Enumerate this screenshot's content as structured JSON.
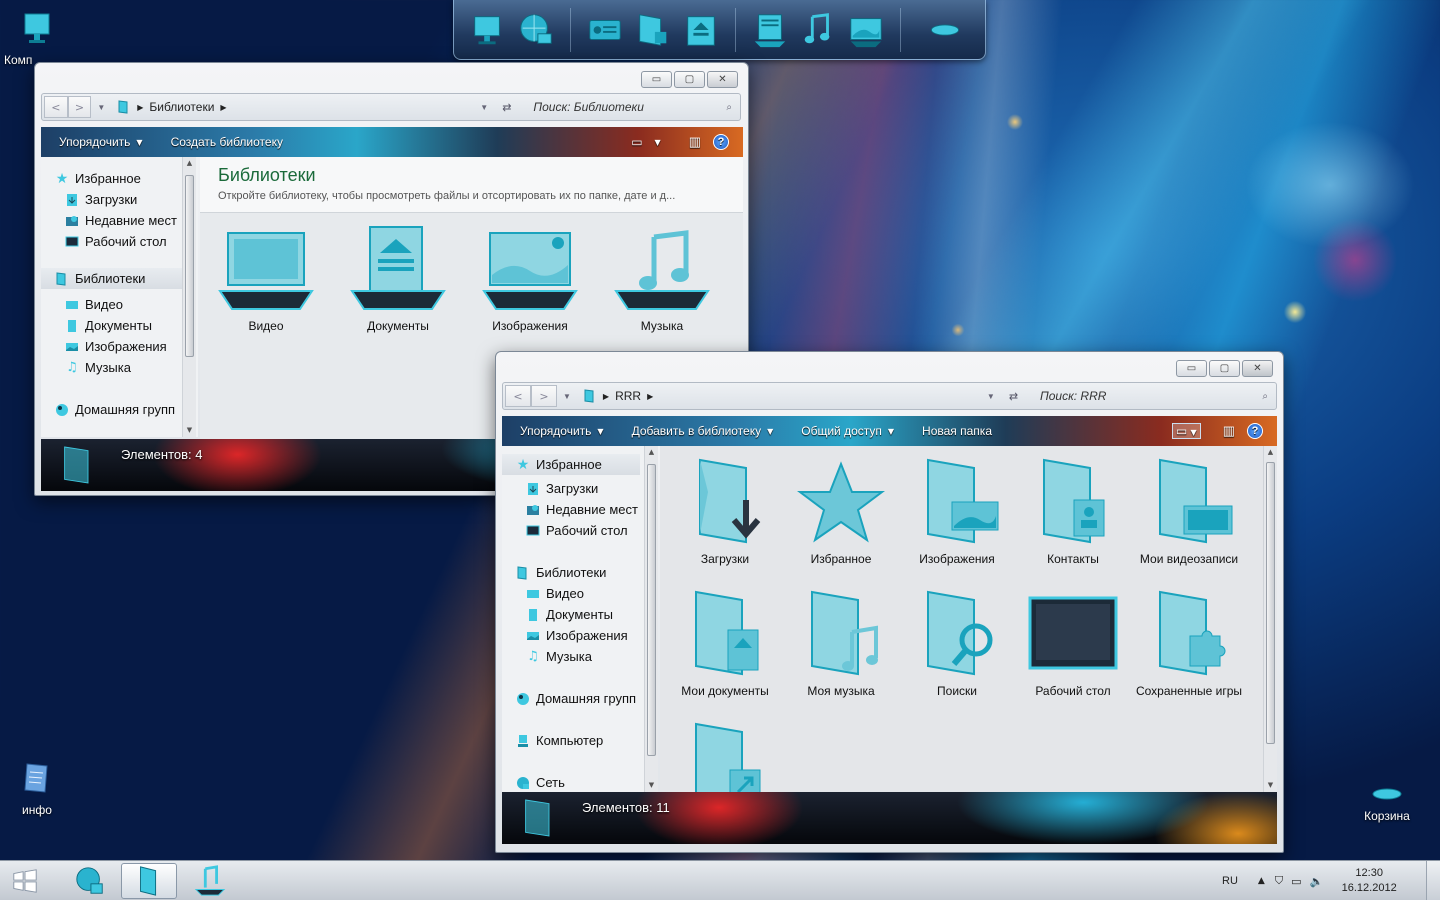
{
  "desktop": {
    "icons": [
      {
        "label": "Комп"
      },
      {
        "label": "инфо"
      },
      {
        "label": "Корзина"
      }
    ]
  },
  "dock": {
    "items": [
      "monitor-icon",
      "globe-icon",
      "display-icon",
      "folder-puzzle-icon",
      "eject-icon",
      "documents-icon",
      "music-icon",
      "picture-icon",
      "switch-icon"
    ]
  },
  "window1": {
    "controls": {
      "minimize": "▭",
      "maximize": "▢",
      "close": "✕"
    },
    "address": {
      "crumb": "Библиотеки"
    },
    "search": {
      "placeholder": "Поиск: Библиотеки"
    },
    "toolbar": {
      "organize": "Упорядочить",
      "create_library": "Создать библиотеку"
    },
    "nav": {
      "favorites": "Избранное",
      "downloads": "Загрузки",
      "recent": "Недавние мест",
      "desktop": "Рабочий стол",
      "libraries": "Библиотеки",
      "video": "Видео",
      "documents": "Документы",
      "pictures": "Изображения",
      "music": "Музыка",
      "homegroup": "Домашняя групп"
    },
    "header": {
      "title": "Библиотеки",
      "subtitle": "Откройте библиотеку, чтобы просмотреть файлы и отсортировать их по папке, дате и д..."
    },
    "tiles": [
      "Видео",
      "Документы",
      "Изображения",
      "Музыка"
    ],
    "status": "Элементов: 4"
  },
  "window2": {
    "controls": {
      "minimize": "▭",
      "maximize": "▢",
      "close": "✕"
    },
    "address": {
      "crumb": "RRR"
    },
    "search": {
      "placeholder": "Поиск: RRR"
    },
    "toolbar": {
      "organize": "Упорядочить",
      "add_to_library": "Добавить в библиотеку",
      "share": "Общий доступ",
      "new_folder": "Новая папка"
    },
    "nav": {
      "favorites": "Избранное",
      "downloads": "Загрузки",
      "recent": "Недавние мест",
      "desktop": "Рабочий стол",
      "libraries": "Библиотеки",
      "video": "Видео",
      "documents": "Документы",
      "pictures": "Изображения",
      "music": "Музыка",
      "homegroup": "Домашняя групп",
      "computer": "Компьютер",
      "network": "Сеть"
    },
    "tiles": [
      {
        "label": "Загрузки",
        "icon": "download-folder-icon"
      },
      {
        "label": "Избранное",
        "icon": "star-icon"
      },
      {
        "label": "Изображения",
        "icon": "pictures-folder-icon"
      },
      {
        "label": "Контакты",
        "icon": "contacts-folder-icon"
      },
      {
        "label": "Мои видеозаписи",
        "icon": "videos-folder-icon"
      },
      {
        "label": "Мои документы",
        "icon": "documents-folder-icon"
      },
      {
        "label": "Моя музыка",
        "icon": "music-folder-icon"
      },
      {
        "label": "Поиски",
        "icon": "search-folder-icon"
      },
      {
        "label": "Рабочий стол",
        "icon": "desktop-screen-icon"
      },
      {
        "label": "Сохраненные игры",
        "icon": "games-folder-icon"
      },
      {
        "label": "",
        "icon": "links-folder-icon"
      }
    ],
    "status": "Элементов: 11"
  },
  "taskbar": {
    "lang": "RU",
    "time": "12:30",
    "date": "16.12.2012"
  },
  "colors": {
    "accent": "#3ec8e0",
    "icon_fill": "#8fd6e2",
    "icon_stroke": "#1aa3bd"
  }
}
